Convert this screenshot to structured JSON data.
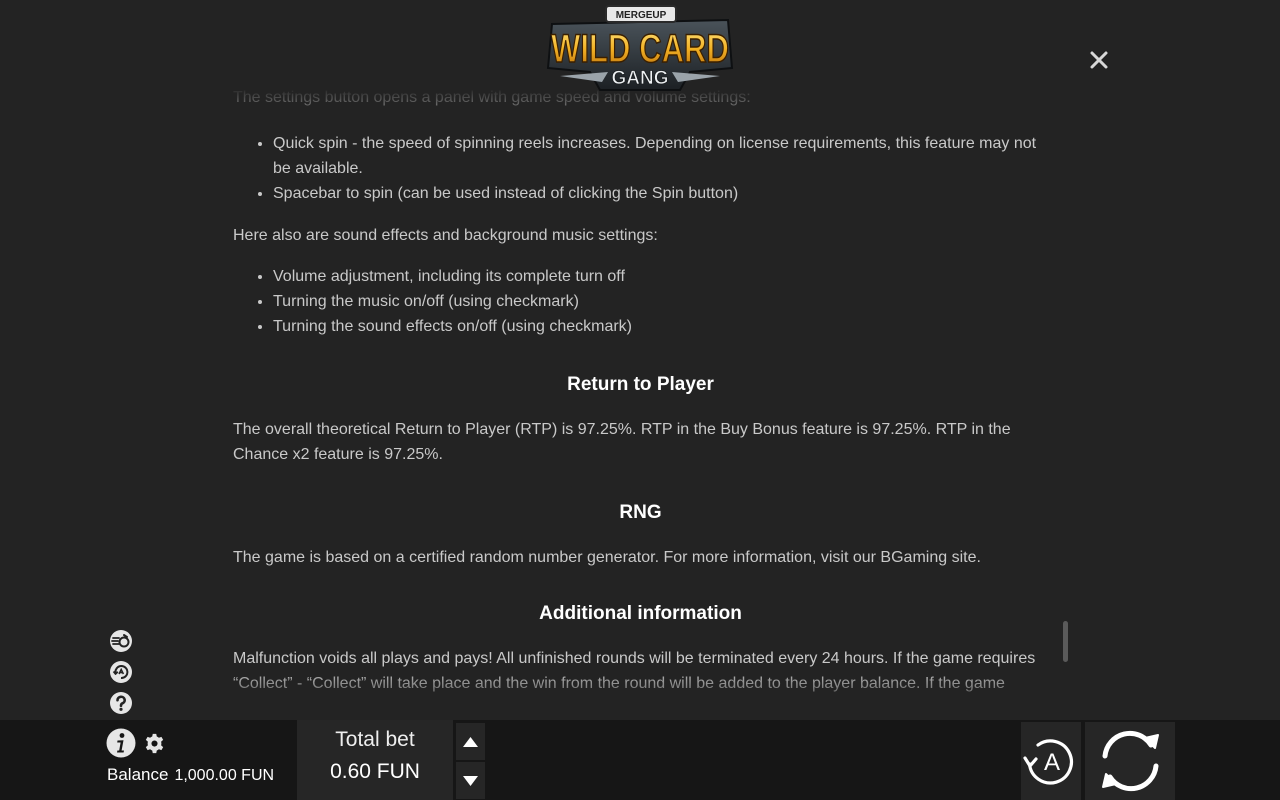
{
  "header": {
    "logo": {
      "brand": "MERGEUP",
      "title": "WILD CARD",
      "subtitle": "GANG"
    },
    "close_icon": "close-icon"
  },
  "rules": {
    "settings_intro": "The settings button opens a panel with game speed and volume settings:",
    "speed_items": [
      "Quick spin - the speed of spinning reels increases. Depending on license requirements, this feature may not be available.",
      "Spacebar to spin (can be used instead of clicking the Spin button)"
    ],
    "sound_intro": "Here also are sound effects and background music settings:",
    "sound_items": [
      "Volume adjustment, including its complete turn off",
      "Turning the music on/off (using checkmark)",
      "Turning the sound effects on/off (using checkmark)"
    ],
    "rtp": {
      "heading": "Return to Player",
      "text": "The overall theoretical Return to Player (RTP) is 97.25%. RTP in the Buy Bonus feature is 97.25%. RTP in the Chance x2 feature is 97.25%."
    },
    "rng": {
      "heading": "RNG",
      "text": "The game is based on a certified random number generator. For more information, visit our BGaming site."
    },
    "additional": {
      "heading": "Additional information",
      "text": "Malfunction voids all plays and pays! All unfinished rounds will be terminated every 24 hours. If the game requires “Collect” - “Collect” will take place and the win from the round will be added to the player balance. If the game"
    }
  },
  "side_icons": [
    "turbo-spin-icon",
    "autoplay-settings-icon",
    "help-icon"
  ],
  "bottom_bar": {
    "balance_label": "Balance",
    "balance_value": "1,000.00 FUN",
    "total_bet_label": "Total bet",
    "total_bet_value": "0.60 FUN",
    "auto_label": "A",
    "colors": {
      "bar": "#161616",
      "panel": "#262626",
      "text": "#ffffff"
    }
  },
  "colors": {
    "background": "#232323",
    "body_text": "#c9c9c9",
    "heading_text": "#ffffff",
    "logo_gold": "#f2b124",
    "logo_steel": "#2b3136"
  }
}
